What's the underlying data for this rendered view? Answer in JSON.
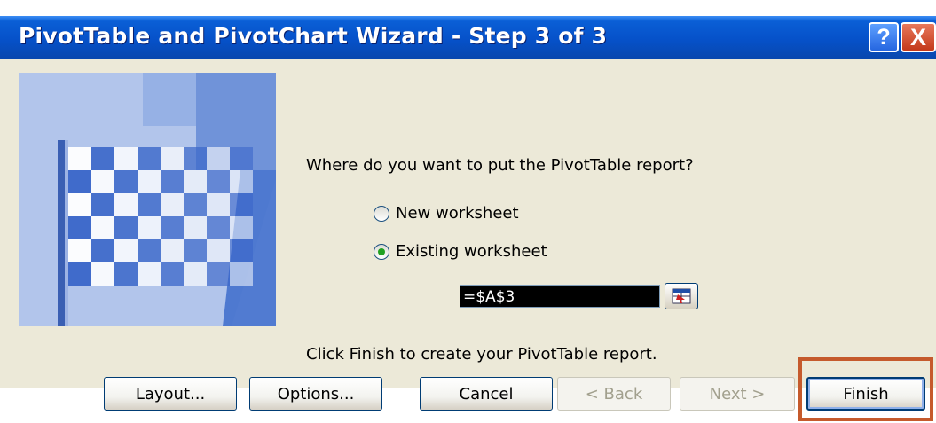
{
  "window": {
    "title": "PivotTable and PivotChart Wizard - Step 3 of 3",
    "help_label": "?",
    "close_label": "X"
  },
  "main": {
    "prompt": "Where do you want to put the PivotTable report?",
    "options": [
      {
        "label": "New worksheet",
        "checked": false
      },
      {
        "label": "Existing worksheet",
        "checked": true
      }
    ],
    "reference_value": "=$A$3",
    "finish_hint": "Click Finish to create your PivotTable report."
  },
  "buttons": {
    "layout": "Layout...",
    "options": "Options...",
    "cancel": "Cancel",
    "back": "< Back",
    "next": "Next >",
    "finish": "Finish"
  },
  "colors": {
    "titlebar": "#0651c9",
    "dialog_bg": "#ece9d8",
    "highlight": "#c55a2c",
    "checkered_blue": "#3a66c9"
  },
  "icons": [
    "help-icon",
    "close-icon",
    "checkered-flag-icon",
    "range-picker-icon"
  ]
}
